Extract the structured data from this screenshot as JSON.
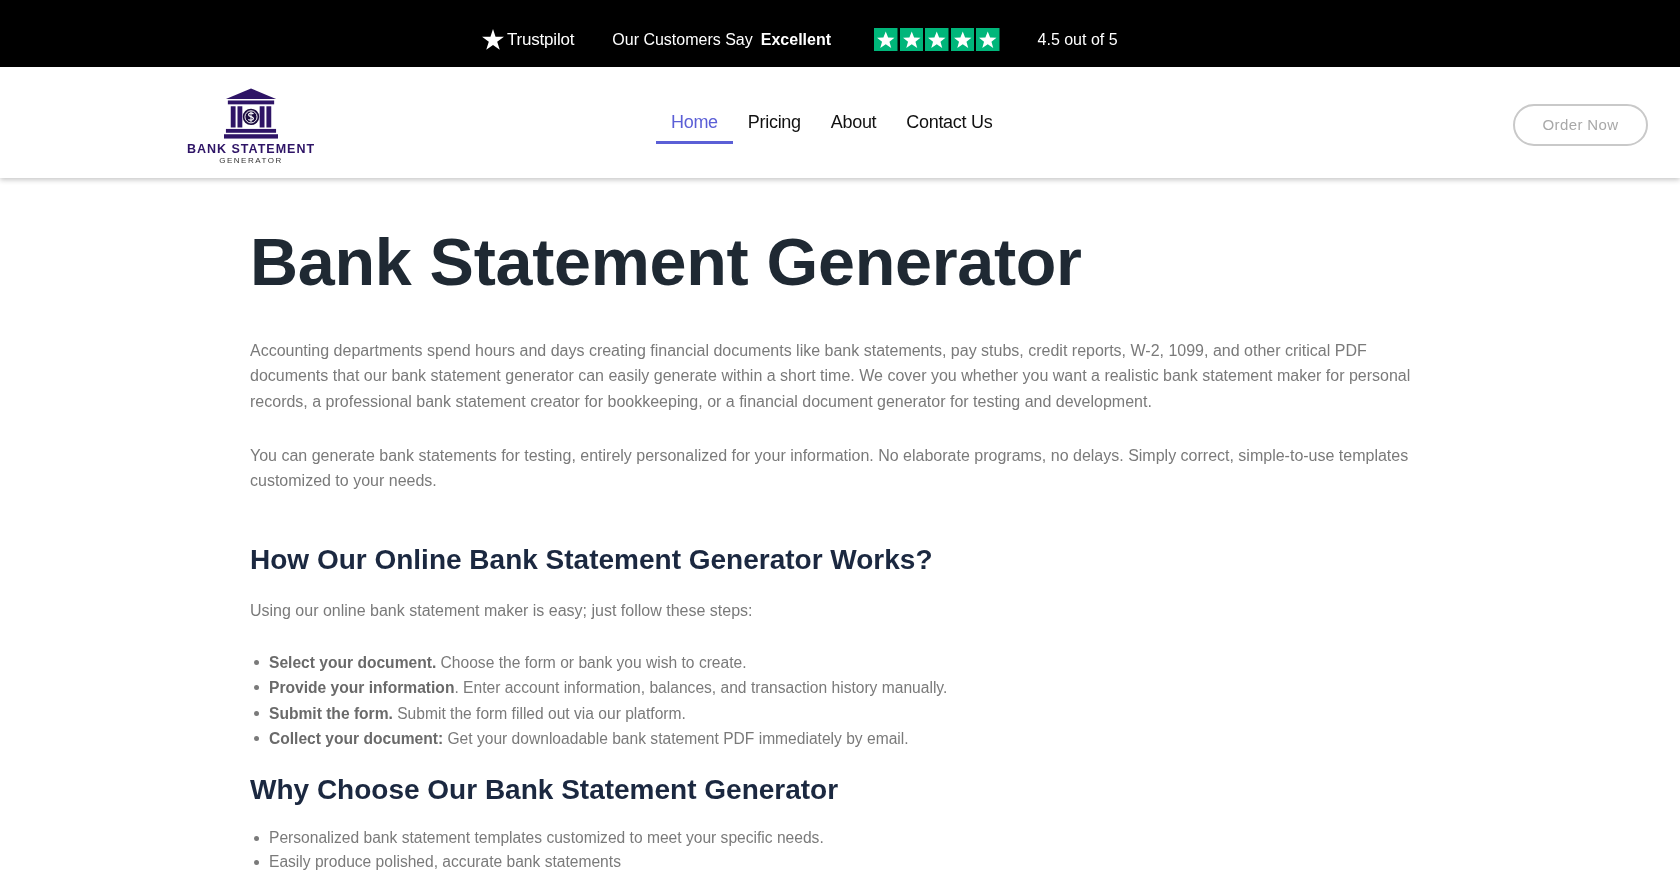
{
  "top_bar": {
    "brand": "Trustpilot",
    "tagline": "Our Customers Say",
    "rating_word": "Excellent",
    "stars": 5,
    "score": "4.5 out of 5"
  },
  "header": {
    "logo": {
      "title": "BANK STATEMENT",
      "subtitle": "GENERATOR"
    },
    "nav": [
      {
        "label": "Home",
        "selected": true
      },
      {
        "label": "Pricing",
        "selected": false
      },
      {
        "label": "About",
        "selected": false
      },
      {
        "label": "Contact Us",
        "selected": false
      }
    ],
    "cta": "Order Now"
  },
  "main": {
    "title": "Bank Statement Generator",
    "paragraphs": [
      "Accounting departments spend hours and days creating financial documents like bank statements, pay stubs, credit reports, W-2, 1099, and other critical PDF documents that our bank statement generator can easily generate within a short time. We cover you whether you want a realistic bank statement maker for personal records, a professional bank statement creator for bookkeeping, or a financial document generator for testing and development.",
      "You can generate bank statements for testing, entirely personalized for your information. No elaborate programs, no delays. Simply correct, simple-to-use templates customized to your needs."
    ],
    "sections": [
      {
        "heading": "How Our Online Bank Statement Generator Works?",
        "intro": "Using our online bank statement maker is easy; just follow these steps:",
        "items": [
          "**Select your document.** Choose the form or bank you wish to create.",
          "**Provide your information**. Enter account information, balances, and transaction history manually.",
          "**Submit the form.** Submit the form filled out via our platform.",
          "**Collect your document:** Get your downloadable bank statement PDF immediately by email."
        ]
      },
      {
        "heading": "Why Choose Our Bank Statement Generator",
        "items": [
          "Personalized bank statement templates customized to meet your specific needs.",
          "Easily produce polished, accurate bank statements"
        ]
      }
    ]
  }
}
